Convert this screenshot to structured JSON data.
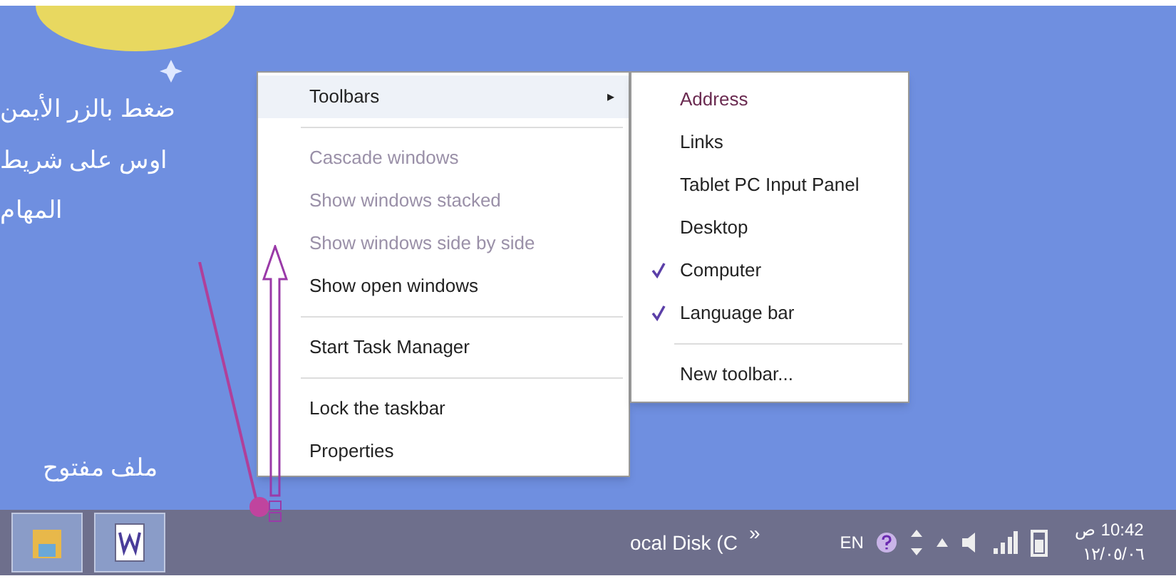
{
  "desktop": {
    "note_lines": [
      "ضغط بالزر الأيمن",
      "اوس على شريط",
      "المهام"
    ],
    "file_label": "ملف مفتوح"
  },
  "context_menu": {
    "items": [
      {
        "kind": "submenu",
        "label": "Toolbars",
        "disabled": false,
        "arrow": "▸"
      },
      {
        "kind": "separator"
      },
      {
        "kind": "item",
        "label": "Cascade windows",
        "disabled": true
      },
      {
        "kind": "item",
        "label": "Show windows stacked",
        "disabled": true
      },
      {
        "kind": "item",
        "label": "Show windows side by side",
        "disabled": true
      },
      {
        "kind": "item",
        "label": "Show open windows",
        "disabled": false
      },
      {
        "kind": "separator"
      },
      {
        "kind": "item",
        "label": "Start Task Manager",
        "disabled": false
      },
      {
        "kind": "separator"
      },
      {
        "kind": "item",
        "label": "Lock the taskbar",
        "disabled": false
      },
      {
        "kind": "item",
        "label": "Properties",
        "disabled": false
      }
    ]
  },
  "toolbars_submenu": {
    "items": [
      {
        "kind": "item",
        "label": "Address",
        "checked": false
      },
      {
        "kind": "item",
        "label": "Links",
        "checked": false
      },
      {
        "kind": "item",
        "label": "Tablet PC Input Panel",
        "checked": false
      },
      {
        "kind": "item",
        "label": "Desktop",
        "checked": false
      },
      {
        "kind": "item",
        "label": "Computer",
        "checked": true
      },
      {
        "kind": "item",
        "label": "Language bar",
        "checked": true
      },
      {
        "kind": "separator"
      },
      {
        "kind": "item",
        "label": "New toolbar...",
        "checked": false
      }
    ]
  },
  "taskbar": {
    "toolbar_label": "ocal Disk (C",
    "overflow": "»",
    "language": "EN",
    "time": "10:42 ص",
    "date": "١٢/٠٥/٠٦"
  }
}
